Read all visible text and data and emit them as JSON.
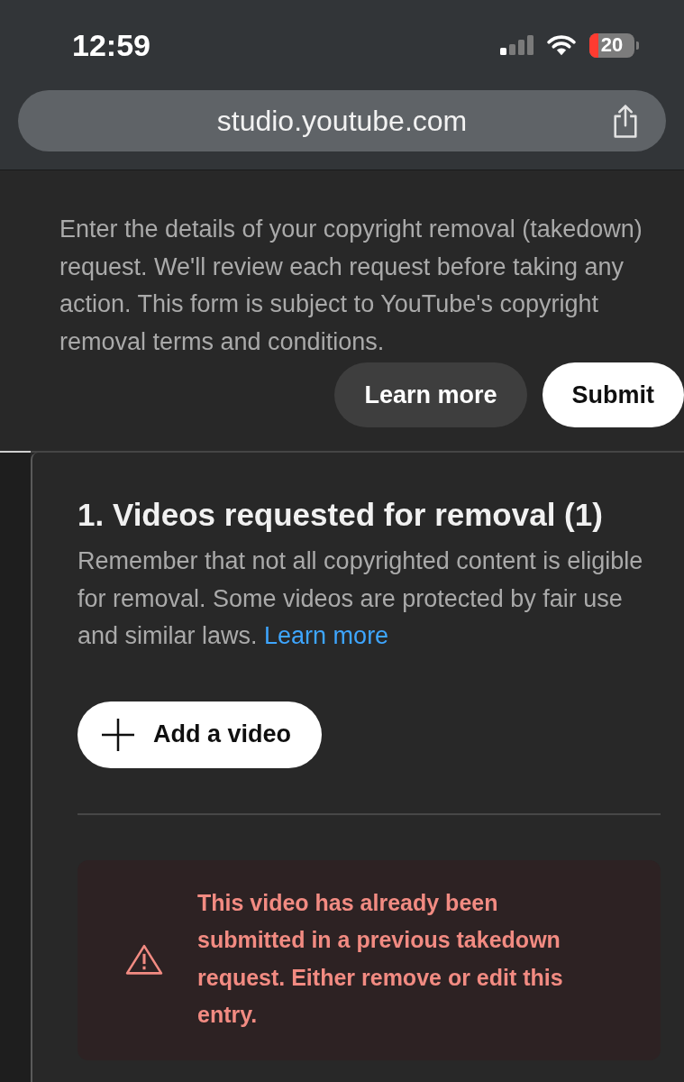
{
  "status_bar": {
    "time": "12:59",
    "battery": "20"
  },
  "address_bar": {
    "url": "studio.youtube.com"
  },
  "intro": {
    "text": "Enter the details of your copyright removal (takedown) request. We'll review each request before taking any action. This form is subject to YouTube's copyright removal terms and conditions.",
    "buttons": [
      {
        "label": "Learn more",
        "kind": "secondary"
      },
      {
        "label": "Submit",
        "kind": "primary"
      }
    ]
  },
  "videos_section": {
    "title": "1. Videos requested for removal (1)",
    "description": "Remember that not all copyrighted content is eligible for removal. Some videos are protected by fair use and similar laws.",
    "link": "Learn more",
    "add_button": "Add a video",
    "error": "This video has already been submitted in a previous takedown request. Either remove or edit this entry."
  }
}
